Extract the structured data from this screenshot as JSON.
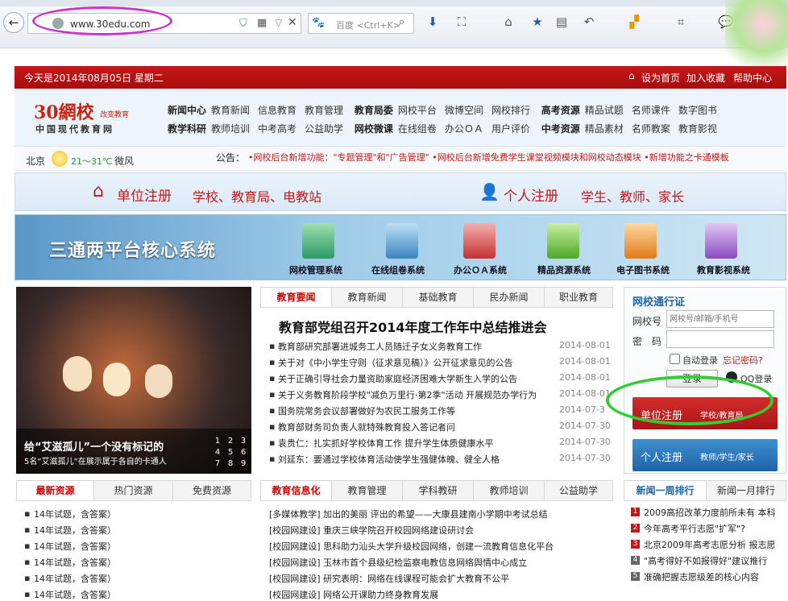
{
  "browser": {
    "url": "www.30edu.com",
    "search_placeholder": "百度 <Ctrl+K>"
  },
  "topbar": {
    "date": "今天是2014年08月05日 星期二",
    "set_home": "设为首页",
    "add_fav": "加入收藏",
    "help": "帮助中心"
  },
  "logo": {
    "main": "30網校",
    "sub": "改变教育",
    "tagline": "中国现代教育网"
  },
  "nav": {
    "row1": [
      [
        "新闻中心",
        "教育新闻",
        "信息教育",
        "教育管理"
      ],
      [
        "教育局委",
        "网校平台",
        "微博空间",
        "网校排行"
      ],
      [
        "高考资源",
        "精品试题",
        "名师课件",
        "数字图书"
      ]
    ],
    "row2": [
      [
        "教学科研",
        "教师培训",
        "中考高考",
        "公益助学"
      ],
      [
        "网校微课",
        "在线组卷",
        "办公ＯＡ",
        "用户评价"
      ],
      [
        "中考资源",
        "精品素材",
        "名师教案",
        "教育影视"
      ]
    ]
  },
  "weather": {
    "city": "北京",
    "temp": "21～31℃",
    "wind": "微风",
    "notice_label": "公告：",
    "notice": "•网校后台新增功能：\"专题管理\"和\"广告管理\"  •网校后台新增免费学生课堂视频模块和网校动态模块  •新增功能之卡通模板"
  },
  "register": {
    "unit": "单位注册",
    "unit_sub": "学校、教育局、电教站",
    "person": "个人注册",
    "person_sub": "学生、教师、家长"
  },
  "banner": {
    "title": "三通两平台核心系统",
    "items": [
      "网校管理系统",
      "在线组卷系统",
      "办公ＯＡ系统",
      "精品资源系统",
      "电子图书系统",
      "教育影视系统"
    ]
  },
  "photo": {
    "caption": "给“艾滋孤儿”一个没有标记的",
    "sub": "5名“艾滋孤儿”在展示属于各自的卡通人",
    "pages": [
      "1",
      "2",
      "3",
      "4",
      "5",
      "6",
      "7",
      "8",
      "9"
    ]
  },
  "news": {
    "tabs": [
      "教育要闻",
      "教育新闻",
      "基础教育",
      "民办新闻",
      "职业教育"
    ],
    "headline": "教育部党组召开2014年度工作年中总结推进会",
    "items": [
      [
        "教育部研究部署进城务工人员随迁子女义务教育工作",
        "2014-08-01"
      ],
      [
        "关于对《中小学生守则（征求意见稿）》公开征求意见的公告",
        "2014-08-01"
      ],
      [
        "关于正确引导社会力量资助家庭经济困难大学新生入学的公告",
        "2014-08-01"
      ],
      [
        "关于义务教育阶段学校\"减负万里行·第2季\"活动 开展规范办学行为",
        "2014-08-01"
      ],
      [
        "国务院常务会议部署做好为农民工服务工作等",
        "2014-07-3"
      ],
      [
        "教育部财务司负责人就特殊教育投入答记者问",
        "2014-07-30"
      ],
      [
        "袁贵仁：扎实抓好学校体育工作 提升学生体质健康水平",
        "2014-07-30"
      ],
      [
        "刘延东：要通过学校体育活动使学生强健体魄、健全人格",
        "2014-07-30"
      ]
    ]
  },
  "login": {
    "title": "网校通行证",
    "user_label": "网校号",
    "user_placeholder": "网校号/邮箱/手机号",
    "pwd_label": "密　码",
    "auto": "自动登录",
    "forgot": "忘记密码?",
    "login_btn": "登录",
    "qq": "QQ登录",
    "unit_btn": "单位注册",
    "unit_sub": "学校/教育局",
    "person_btn": "个人注册",
    "person_sub": "教师/学生/家长"
  },
  "resources": {
    "tabs": [
      "最新资源",
      "热门资源",
      "免费资源"
    ],
    "items": [
      "14年试题，含答案）",
      "14年试题，含答案）",
      "14年试题，含答案）",
      "14年试题，含答案）",
      "14年试题，含答案）",
      "14年试题，含答案）"
    ]
  },
  "info": {
    "tabs": [
      "教育信息化",
      "教育管理",
      "学科教研",
      "教师培训",
      "公益助学"
    ],
    "items": [
      "[多媒体教学] 加出的美丽 评出的希望——大康县建南小学期中考试总结",
      "[校园网建设] 重庆三峡学院召开校园网络建设研讨会",
      "[校园网建设] 思科助力汕头大学升级校园网络，创建一流教育信息化平台",
      "[校园网建设] 玉林市首个县级纪检监察电教信息网络舆情中心成立",
      "[校园网建设] 研究表明：网络在线课程可能会扩大教育不公平",
      "[校园网建设] 网络公开课助力终身教育发展"
    ]
  },
  "ranking": {
    "tabs": [
      "新闻一周排行",
      "新闻一月排行"
    ],
    "items": [
      "2009高招改革力度前所未有 本科",
      "今年高考平行志愿\"扩军\"?",
      "北京2009年高考志愿分析 报志愿",
      "\"高考得好不如报得好\"建议推行",
      "准确把握志愿级差的核心内容"
    ]
  },
  "colors": {
    "accent_red": "#c21818",
    "link_blue": "#1f63a8",
    "ring_magenta": "#cc33cc",
    "ring_green": "#33cc33"
  }
}
